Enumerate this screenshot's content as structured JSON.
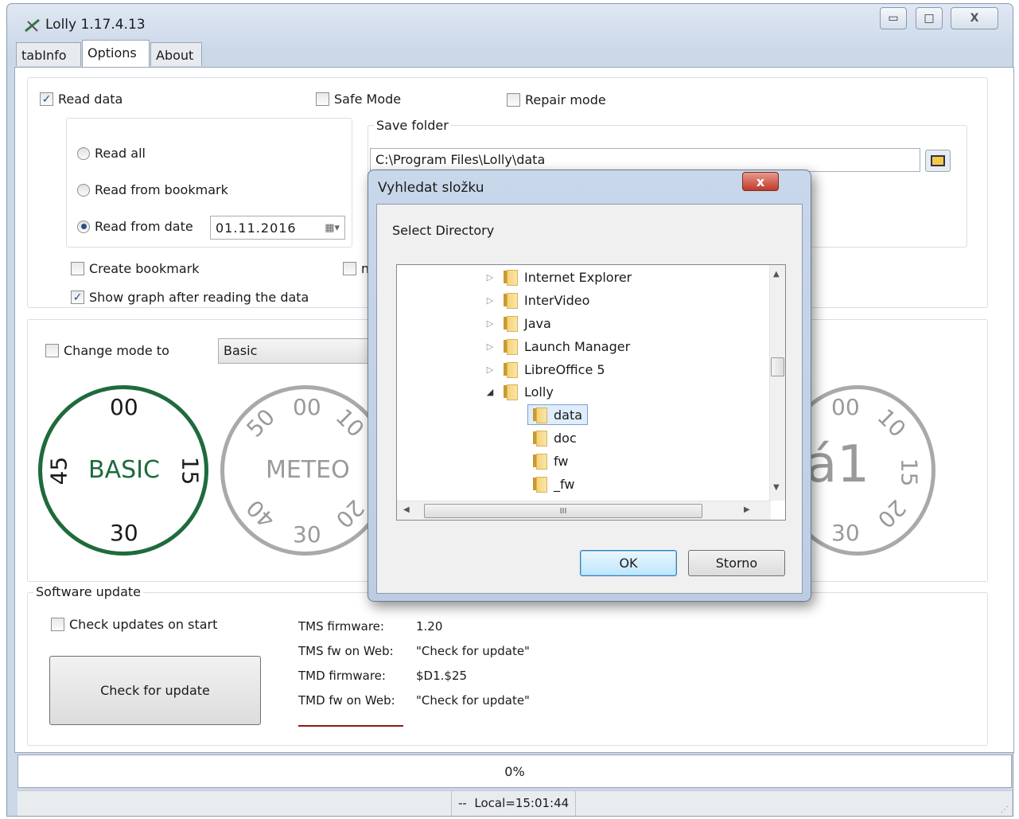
{
  "window": {
    "title": "Lolly 1.17.4.13",
    "icon": "app-icon"
  },
  "caption_buttons": {
    "minimize": "▭",
    "maximize": "□",
    "close": "X"
  },
  "tabs": [
    {
      "label": "tabInfo"
    },
    {
      "label": "Options"
    },
    {
      "label": "About"
    }
  ],
  "options": {
    "read_data": {
      "label": "Read data",
      "checked": true
    },
    "safe_mode": {
      "label": "Safe Mode",
      "checked": false
    },
    "repair_mode": {
      "label": "Repair mode",
      "checked": false
    },
    "read_all": {
      "label": "Read all"
    },
    "read_from_bookmark": {
      "label": "Read from bookmark"
    },
    "read_from_date": {
      "label": "Read from date",
      "value": "01.11.2016"
    },
    "save_folder": {
      "label": "Save folder",
      "value": "C:\\Program Files\\Lolly\\data"
    },
    "create_bookmark": {
      "label": "Create bookmark",
      "checked": false
    },
    "hidden_check_label": "n",
    "show_graph": {
      "label": "Show graph after reading the data",
      "checked": true
    },
    "change_mode": {
      "label": "Change mode to",
      "value": "Basic"
    }
  },
  "dials": {
    "basic": {
      "top": "00",
      "right": "15",
      "bottom": "30",
      "left": "45",
      "center": "BASIC",
      "color": "#1e6b3c"
    },
    "meteo": {
      "top": "00",
      "top_right": "10",
      "bottom": "30",
      "bottom_right": "20",
      "top_left": "50",
      "bottom_left": "40",
      "center": "METEO",
      "color": "#9a9a9a"
    },
    "right": {
      "top": "00",
      "top_right": "10",
      "right": "15",
      "bottom_right": "20",
      "bottom": "30",
      "center": "á1",
      "color": "#9a9a9a"
    }
  },
  "software_update": {
    "title": "Software update",
    "check_on_start": {
      "label": "Check updates on start",
      "checked": false
    },
    "button": "Check for update",
    "rows": [
      {
        "key": "TMS firmware:",
        "value": "1.20"
      },
      {
        "key": "TMS fw on Web:",
        "value": "\"Check for update\""
      },
      {
        "key": "TMD firmware:",
        "value": "$D1.$25"
      },
      {
        "key": "TMD fw on Web:",
        "value": "\"Check for update\""
      }
    ],
    "accent_line_color": "#8b1a1a"
  },
  "progress": {
    "text": "0%",
    "value": 0
  },
  "statusbar": {
    "left": "--",
    "time": "Local=15:01:44"
  },
  "dialog": {
    "title": "Vyhledat složku",
    "close": "x",
    "prompt": "Select Directory",
    "tree": [
      {
        "label": "Internet Explorer",
        "arrow": "▷",
        "level": 0
      },
      {
        "label": "InterVideo",
        "arrow": "▷",
        "level": 0
      },
      {
        "label": "Java",
        "arrow": "▷",
        "level": 0
      },
      {
        "label": "Launch Manager",
        "arrow": "▷",
        "level": 0
      },
      {
        "label": "LibreOffice 5",
        "arrow": "▷",
        "level": 0
      },
      {
        "label": "Lolly",
        "arrow": "◢",
        "level": 0
      },
      {
        "label": "data",
        "arrow": "",
        "level": 1,
        "selected": true
      },
      {
        "label": "doc",
        "arrow": "",
        "level": 1
      },
      {
        "label": "fw",
        "arrow": "",
        "level": 1
      },
      {
        "label": "_fw",
        "arrow": "",
        "level": 1
      }
    ],
    "hscroll_grip": "III",
    "ok": "OK",
    "cancel": "Storno"
  }
}
